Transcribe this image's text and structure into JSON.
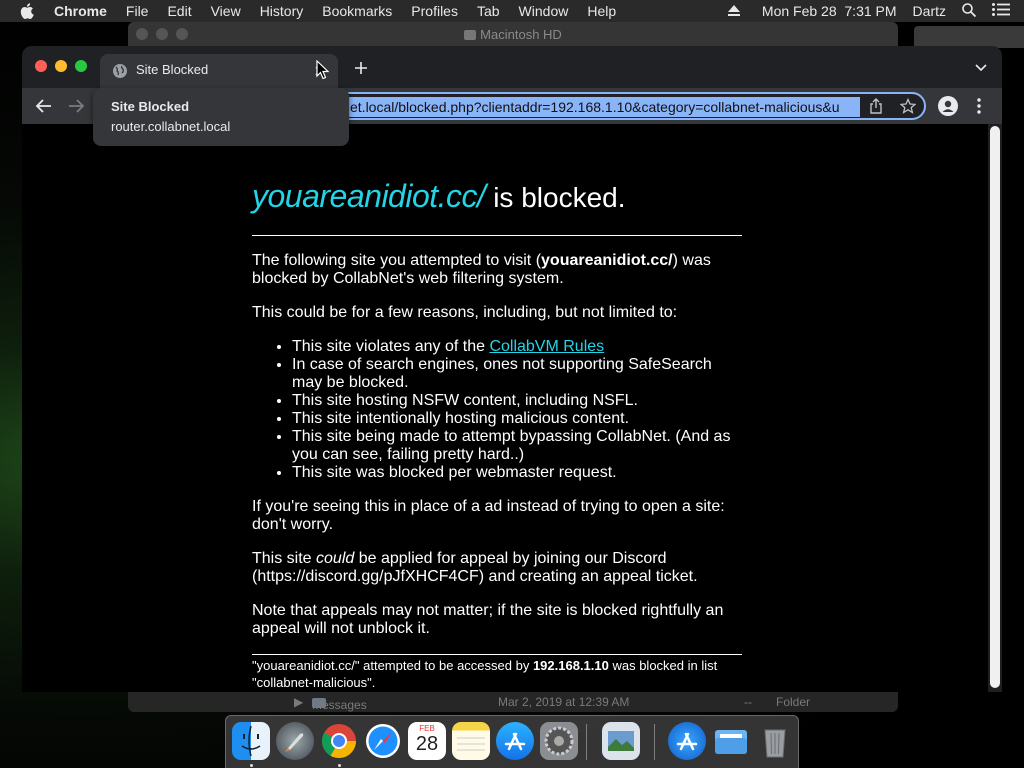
{
  "menubar": {
    "app": "Chrome",
    "items": [
      "File",
      "Edit",
      "View",
      "History",
      "Bookmarks",
      "Profiles",
      "Tab",
      "Window",
      "Help"
    ],
    "clock": "Mon Feb 28  7:31 PM",
    "user": "Dartz"
  },
  "background_window": {
    "title": "Macintosh HD",
    "row_name": "Messages",
    "row_date": "Mar 2, 2019 at 12:39 AM",
    "row_size": "--",
    "row_kind": "Folder"
  },
  "browser": {
    "tab_title": "Site Blocked",
    "url_visible": "et.local/blocked.php?clientaddr=192.168.1.10&category=collabnet-malicious&u",
    "tooltip": {
      "title": "Site Blocked",
      "host": "router.collabnet.local"
    }
  },
  "page": {
    "heading_site": "youareanidiot.cc/",
    "heading_rest": " is blocked.",
    "p1_a": "The following site you attempted to visit (",
    "p1_site": "youareanidiot.cc/",
    "p1_b": ") was blocked by CollabNet's web filtering system.",
    "p2": "This could be for a few reasons, including, but not limited to:",
    "reason1_pre": "This site violates any of the ",
    "reason1_link": "CollabVM Rules",
    "reasons": [
      "In case of search engines, ones not supporting SafeSearch may be blocked.",
      "This site hosting NSFW content, including NSFL.",
      "This site intentionally hosting malicious content.",
      "This site being made to attempt bypassing CollabNet. (And as you can see, failing pretty hard..)",
      "This site was blocked per webmaster request."
    ],
    "p3": "If you're seeing this in place of a ad instead of trying to open a site: don't worry.",
    "p4_a": "This site ",
    "p4_em": "could",
    "p4_b": " be applied for appeal by joining our Discord (https://discord.gg/pJfXHCF4CF) and creating an appeal ticket.",
    "p5": "Note that appeals may not matter; if the site is blocked rightfully an appeal will not unblock it.",
    "footer_a": "\"youareanidiot.cc/\" attempted to be accessed by ",
    "footer_ip": "192.168.1.10",
    "footer_b": " was blocked in list \"collabnet-malicious\"."
  },
  "dock": {
    "apps": [
      "finder-icon",
      "launchpad-icon",
      "chrome-icon",
      "safari-icon",
      "calendar-icon",
      "notes-icon",
      "app-store-icon",
      "system-preferences-icon",
      "preview-icon",
      "applications-folder-icon",
      "documents-folder-icon",
      "trash-icon"
    ],
    "calendar_month": "FEB",
    "calendar_day": "28"
  },
  "colors": {
    "link": "#22d4e6",
    "focus_ring": "#8ab4f8",
    "tab": "#35363a"
  }
}
